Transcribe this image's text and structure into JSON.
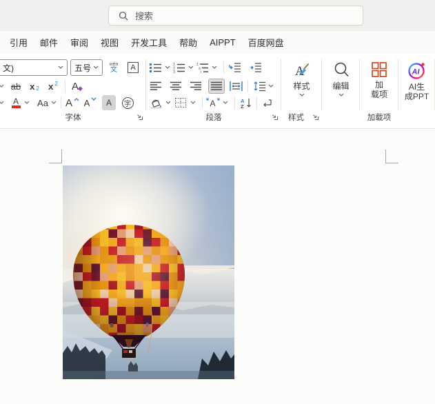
{
  "titlebar": {
    "search_placeholder": "搜索"
  },
  "menu_tabs": [
    "引用",
    "邮件",
    "审阅",
    "视图",
    "开发工具",
    "帮助",
    "AIPPT",
    "百度网盘"
  ],
  "ribbon": {
    "font": {
      "group_label": "字体",
      "font_name_value": "文)",
      "font_size_value": "五号",
      "phonetic_top": "wén",
      "phonetic_bottom": "文",
      "char_border": "A",
      "strikethrough": "ab",
      "sub_base": "x",
      "sub_small": "2",
      "sup_base": "x",
      "sup_small": "2",
      "text_effects": "A",
      "font_color": "A",
      "change_case": "Aa",
      "grow_font": "A",
      "shrink_font": "A",
      "char_shading": "A",
      "enclose_char": "字"
    },
    "paragraph": {
      "group_label": "段落",
      "sort_a": "A",
      "sort_z": "Z"
    },
    "styles": {
      "group_label": "样式",
      "button_label": "样式"
    },
    "editing": {
      "button_label": "编辑"
    },
    "addins": {
      "group_label": "加载项",
      "button_line1": "加",
      "button_line2": "载项"
    },
    "ai": {
      "button_line1": "AI生",
      "button_line2": "成PPT",
      "logo_text": "AI"
    }
  },
  "document": {
    "image": {
      "alt": "Checkered orange, red and maroon hot air balloon floating above misty blue mountains",
      "palette": [
        "#E59012",
        "#F2A51C",
        "#C41A22",
        "#A01220",
        "#5C1530",
        "#EFC9A4",
        "#E29A72",
        "#F4B822",
        "#721628"
      ]
    }
  },
  "colors": {
    "icon_blue": "#2a7ad4",
    "font_color_red": "#e3291f",
    "addins_orange": "#c84a21",
    "effects_purple": "#a33fc4"
  }
}
